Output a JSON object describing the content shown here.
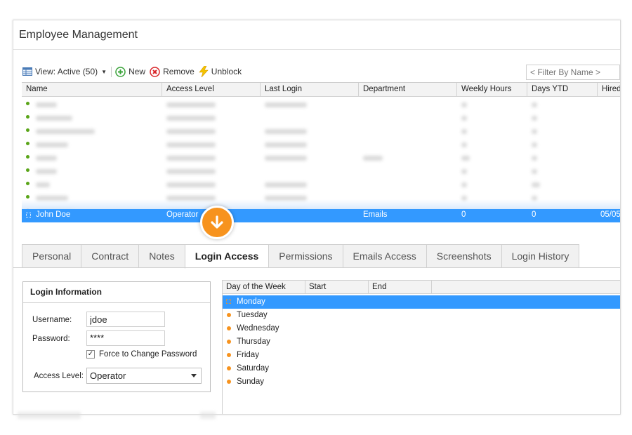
{
  "app": {
    "title": "Employee Management"
  },
  "toolbar": {
    "view_label": "View: Active (50)",
    "new_label": "New",
    "remove_label": "Remove",
    "unblock_label": "Unblock"
  },
  "filter": {
    "placeholder": "< Filter By Name >"
  },
  "grid": {
    "columns": [
      "Name",
      "Access Level",
      "Last Login",
      "Department",
      "Weekly Hours",
      "Days YTD",
      "Hired"
    ],
    "blurred_row_status_colors": [
      "#5aa519",
      "#5aa519",
      "#5aa519",
      "#5aa519",
      "#5aa519",
      "#5aa519",
      "#5aa519",
      "#5aa519",
      "#f7931e"
    ],
    "selected_row": {
      "name": "John Doe",
      "access_level": "Operator",
      "last_login": "",
      "department": "Emails",
      "weekly_hours": "0",
      "days_ytd": "0",
      "hired": "05/05"
    }
  },
  "arrow_icon": "arrow-down-icon",
  "tabs": [
    "Personal",
    "Contract",
    "Notes",
    "Login Access",
    "Permissions",
    "Emails Access",
    "Screenshots",
    "Login History"
  ],
  "active_tab": "Login Access",
  "login_info": {
    "title": "Login Information",
    "username_label": "Username:",
    "username_value": "jdoe",
    "password_label": "Password:",
    "password_value": "****",
    "force_change_label": "Force to Change Password",
    "force_change_checked": true,
    "access_level_label": "Access Level:",
    "access_level_value": "Operator"
  },
  "schedule": {
    "columns": [
      "Day of the Week",
      "Start",
      "End"
    ],
    "days": [
      "Monday",
      "Tuesday",
      "Wednesday",
      "Thursday",
      "Friday",
      "Saturday",
      "Sunday"
    ],
    "selected_day": "Monday"
  },
  "colors": {
    "selection": "#3399ff",
    "accent": "#f7931e",
    "active_status": "#5aa519"
  }
}
